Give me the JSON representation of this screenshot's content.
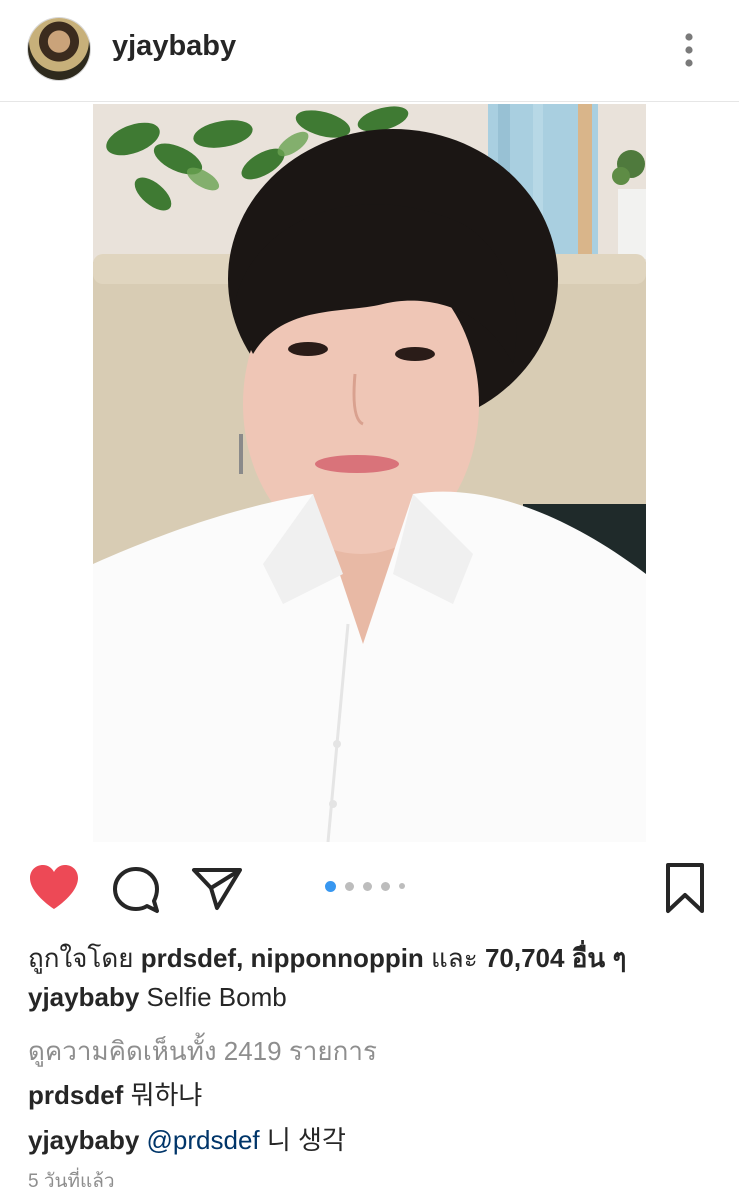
{
  "header": {
    "username": "yjaybaby",
    "avatar_icon": "user-avatar",
    "menu_icon": "more-vertical-icon"
  },
  "post": {
    "image_desc": "photo"
  },
  "actions": {
    "like_icon": "heart-icon",
    "like_state": "liked",
    "like_color": "#ed4956",
    "comment_icon": "comment-icon",
    "share_icon": "send-icon",
    "save_icon": "bookmark-icon",
    "carousel": {
      "count": 5,
      "active_index": 0,
      "active_color": "#3897f0"
    }
  },
  "likes": {
    "prefix": "ถูกใจโดย",
    "user1": "prdsdef",
    "sep": ",",
    "user2": "nipponnoppin",
    "and": "และ",
    "count": "70,704",
    "suffix": "อื่น ๆ"
  },
  "caption": {
    "username": "yjaybaby",
    "text": "Selfie Bomb"
  },
  "view_comments": "ดูความคิดเห็นทั้ง 2419 รายการ",
  "comments": [
    {
      "username": "prdsdef",
      "text": "뭐하냐"
    },
    {
      "username": "yjaybaby",
      "mention": "@prdsdef",
      "text": "니 생각"
    }
  ],
  "timestamp": "5 วันที่แล้ว"
}
